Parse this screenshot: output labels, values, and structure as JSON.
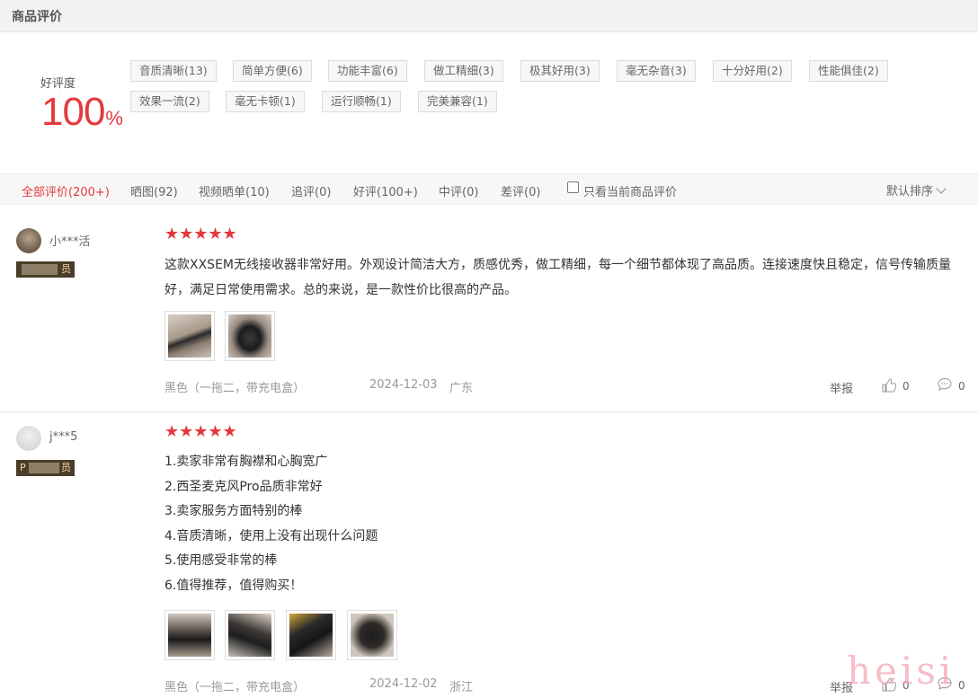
{
  "header": {
    "title": "商品评价"
  },
  "summary": {
    "rate_label": "好评度",
    "rate_value": "100",
    "rate_unit": "%",
    "tags": [
      "音质清晰(13)",
      "简单方便(6)",
      "功能丰富(6)",
      "做工精细(3)",
      "极其好用(3)",
      "毫无杂音(3)",
      "十分好用(2)",
      "性能俱佳(2)",
      "效果一流(2)",
      "毫无卡顿(1)",
      "运行顺畅(1)",
      "完美兼容(1)"
    ]
  },
  "filters": {
    "items": [
      "全部评价(200+)",
      "晒图(92)",
      "视频晒单(10)",
      "追评(0)",
      "好评(100+)",
      "中评(0)",
      "差评(0)"
    ],
    "only_current": "只看当前商品评价",
    "sort": "默认排序"
  },
  "reviews": [
    {
      "username": "小***活",
      "badge": "员",
      "stars": "★★★★★",
      "content": "这款XXSEM无线接收器非常好用。外观设计简洁大方，质感优秀，做工精细，每一个细节都体现了高品质。连接速度快且稳定，信号传输质量好，满足日常使用需求。总的来说，是一款性价比很高的产品。",
      "variant": "黑色（一拖二，带充电盒）",
      "date": "2024-12-03",
      "region": "广东",
      "report": "举报",
      "likes": "0",
      "comments": "0"
    },
    {
      "username": "j***5",
      "badge": "员",
      "badge_prefix": "P",
      "stars": "★★★★★",
      "lines": [
        "1.卖家非常有胸襟和心胸宽广",
        "2.西圣麦克风Pro品质非常好",
        "3.卖家服务方面特别的棒",
        "4.音质清晰，使用上没有出现什么问题",
        "5.使用感受非常的棒",
        "6.值得推荐，值得购买！"
      ],
      "variant": "黑色（一拖二，带充电盒）",
      "date": "2024-12-02",
      "region": "浙江",
      "report": "举报",
      "likes": "0",
      "comments": "0"
    }
  ],
  "watermark": "heisi",
  "colors": {
    "accent": "#e4393c",
    "badge_bg": "#4a3d2a"
  }
}
